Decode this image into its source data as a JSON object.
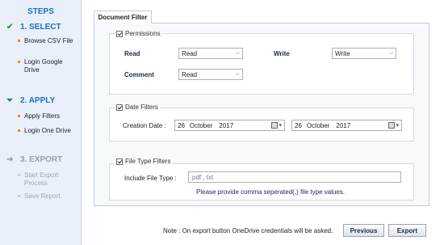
{
  "sidebar": {
    "title": "STEPS",
    "steps": [
      {
        "label": "1. SELECT",
        "state": "done",
        "icon": "checkmark-icon",
        "items": [
          "Browse CSV File",
          "Login Google Drive"
        ]
      },
      {
        "label": "2. APPLY",
        "state": "active",
        "icon": "filter-icon",
        "items": [
          "Apply Filters",
          "Login One Drive"
        ]
      },
      {
        "label": "3. EXPORT",
        "state": "disabled",
        "icon": "export-arrow-icon",
        "items": [
          "Start Export Process",
          "Save Report"
        ]
      }
    ]
  },
  "tab": {
    "label": "Document Filter"
  },
  "permissions": {
    "legend": "Permissions",
    "checked": true,
    "read_label": "Read",
    "read_value": "Read",
    "write_label": "Write",
    "write_value": "Write",
    "comment_label": "Comment",
    "comment_value": "Read"
  },
  "date_filters": {
    "legend": "Date Filters",
    "checked": true,
    "creation_label": "Creation Date :",
    "start": {
      "day": "26",
      "month": "October",
      "year": "2017"
    },
    "end": {
      "day": "26",
      "month": "October",
      "year": "2017"
    }
  },
  "file_type": {
    "legend": "File Type Filters",
    "checked": true,
    "include_label": "Include File Type :",
    "value": "pdf , txt",
    "hint": "Please provide comma seperated(,) file type values."
  },
  "footer": {
    "note": "Note : On export button OneDrive credentials will be asked.",
    "previous_label": "Previous",
    "export_label": "Export"
  },
  "colors": {
    "accent": "#1e70c1",
    "bullet": "#f08a1c",
    "check": "#2f9e2f"
  }
}
